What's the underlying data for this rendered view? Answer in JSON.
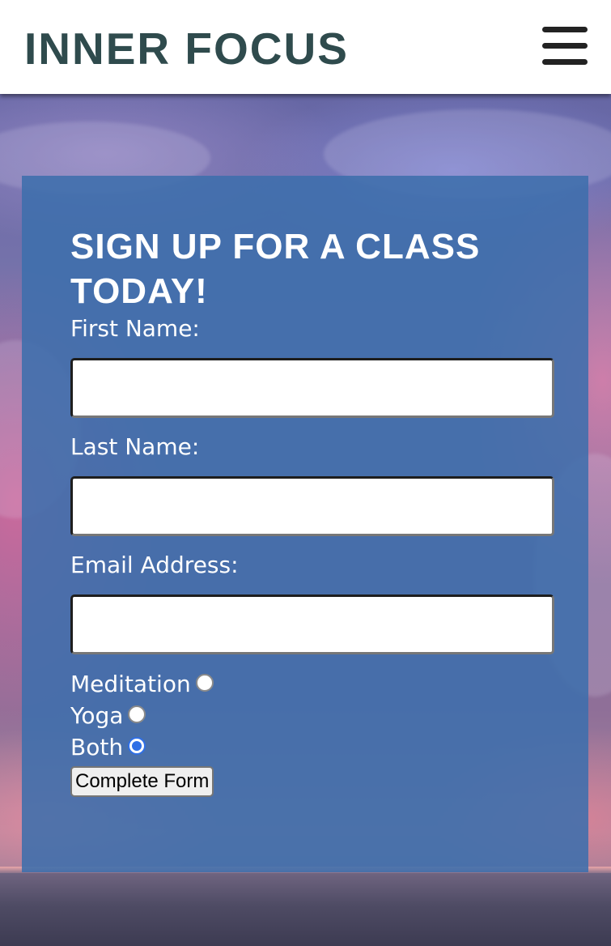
{
  "header": {
    "brand": "INNER FOCUS",
    "menu_icon": "hamburger-menu-icon"
  },
  "form": {
    "title": "SIGN UP FOR A CLASS TODAY!",
    "first_name_label": "First Name:",
    "first_name_value": "",
    "last_name_label": "Last Name:",
    "last_name_value": "",
    "email_label": "Email Address:",
    "email_value": "",
    "class_options": [
      {
        "label": "Meditation",
        "checked": false
      },
      {
        "label": "Yoga",
        "checked": false
      },
      {
        "label": "Both",
        "checked": true
      }
    ],
    "submit_label": "Complete Form"
  },
  "colors": {
    "brand_text": "#2f4b4d",
    "panel_background": "#3e6eac",
    "radio_accent": "#2f6fe6"
  }
}
